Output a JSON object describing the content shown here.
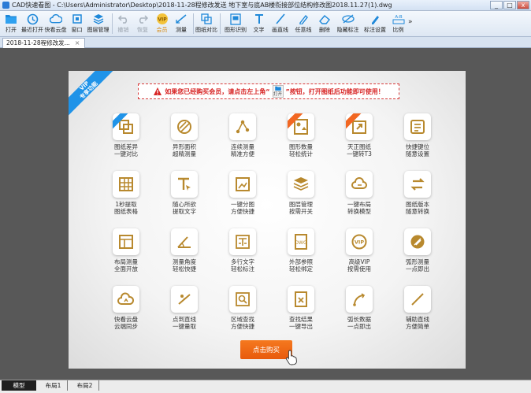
{
  "window": {
    "title": "CAD快速看图 - C:\\Users\\Administrator\\Desktop\\2018-11-28程修改发送 地下室与底AB楼衔接部位结构修改图2018.11.27(1).dwg",
    "buttons": [
      "_",
      "□",
      "x"
    ]
  },
  "toolbar": {
    "items": [
      {
        "label": "打开",
        "icon": "open-folder-icon"
      },
      {
        "label": "最近打开",
        "icon": "recent-icon"
      },
      {
        "label": "快看云盘",
        "icon": "cloud-icon"
      },
      {
        "label": "窗口",
        "icon": "window-icon"
      },
      {
        "label": "图层管理",
        "icon": "layers-icon"
      },
      {
        "label": "撤销",
        "icon": "undo-icon"
      },
      {
        "label": "恢复",
        "icon": "redo-icon"
      },
      {
        "label": "会员",
        "icon": "vip-icon"
      },
      {
        "label": "测量",
        "icon": "measure-icon"
      },
      {
        "label": "图纸对比",
        "icon": "compare-icon"
      },
      {
        "label": "图形识别",
        "icon": "recognize-icon"
      },
      {
        "label": "文字",
        "icon": "text-icon"
      },
      {
        "label": "画直线",
        "icon": "line-icon"
      },
      {
        "label": "任意线",
        "icon": "freeline-icon"
      },
      {
        "label": "删除",
        "icon": "eraser-icon"
      },
      {
        "label": "隐藏标注",
        "icon": "hide-icon"
      },
      {
        "label": "标注设置",
        "icon": "annotation-settings-icon"
      },
      {
        "label": "比例",
        "icon": "scale-icon"
      }
    ],
    "more": "»"
  },
  "doc_tab": {
    "label": "2018-11-28程修改发...",
    "close": "×"
  },
  "panel": {
    "ribbon": [
      "VIP",
      "专享功能"
    ],
    "notice_before": "如果您已经购买会员，请点击左上角“",
    "notice_open": "打开",
    "notice_after": "”按钮，打开图纸后功能即可使用！",
    "features": [
      {
        "l1": "图纸差异",
        "l2": "一键对比",
        "icon": "diff-icon",
        "badge": "new"
      },
      {
        "l1": "异形面积",
        "l2": "超精测量",
        "icon": "area-icon",
        "badge": ""
      },
      {
        "l1": "连续测量",
        "l2": "精准方便",
        "icon": "continuous-measure-icon",
        "badge": ""
      },
      {
        "l1": "图形数量",
        "l2": "轻松统计",
        "icon": "shape-count-icon",
        "badge": "hot"
      },
      {
        "l1": "天正图纸",
        "l2": "一键转T3",
        "icon": "convert-t3-icon",
        "badge": "hot"
      },
      {
        "l1": "快捷键位",
        "l2": "随意设置",
        "icon": "shortcut-icon",
        "badge": ""
      },
      {
        "l1": "1秒提取",
        "l2": "图纸表格",
        "icon": "table-extract-icon",
        "badge": ""
      },
      {
        "l1": "随心所欲",
        "l2": "提取文字",
        "icon": "text-extract-icon",
        "badge": ""
      },
      {
        "l1": "一键分图",
        "l2": "方便快捷",
        "icon": "split-drawing-icon",
        "badge": ""
      },
      {
        "l1": "图层管理",
        "l2": "按需开关",
        "icon": "layer-manage-icon",
        "badge": ""
      },
      {
        "l1": "一键布局",
        "l2": "转换模型",
        "icon": "layout-convert-icon",
        "badge": ""
      },
      {
        "l1": "图纸版本",
        "l2": "随意转换",
        "icon": "version-convert-icon",
        "badge": ""
      },
      {
        "l1": "布局测量",
        "l2": "全面开放",
        "icon": "layout-measure-icon",
        "badge": ""
      },
      {
        "l1": "测量角度",
        "l2": "轻松快捷",
        "icon": "angle-measure-icon",
        "badge": ""
      },
      {
        "l1": "多行文字",
        "l2": "轻松标注",
        "icon": "multiline-text-icon",
        "badge": ""
      },
      {
        "l1": "外部参照",
        "l2": "轻松绑定",
        "icon": "xref-icon",
        "badge": ""
      },
      {
        "l1": "高级VIP",
        "l2": "按需使用",
        "icon": "vip-badge-icon",
        "badge": ""
      },
      {
        "l1": "弧形测量",
        "l2": "一点即出",
        "icon": "arc-measure-icon",
        "badge": ""
      },
      {
        "l1": "快看云盘",
        "l2": "云端同步",
        "icon": "cloud-sync-icon",
        "badge": ""
      },
      {
        "l1": "点到直线",
        "l2": "一键量取",
        "icon": "point-line-icon",
        "badge": ""
      },
      {
        "l1": "区域查找",
        "l2": "方便快捷",
        "icon": "area-search-icon",
        "badge": ""
      },
      {
        "l1": "查找结果",
        "l2": "一键导出",
        "icon": "export-results-icon",
        "badge": ""
      },
      {
        "l1": "弧长数据",
        "l2": "一点即出",
        "icon": "arc-length-icon",
        "badge": ""
      },
      {
        "l1": "辅助直线",
        "l2": "方便简单",
        "icon": "aux-line-icon",
        "badge": ""
      }
    ],
    "buy_label": "点击购买"
  },
  "layout_tabs": [
    "模型",
    "布局1",
    "布局2"
  ],
  "colors": {
    "accent_blue": "#1f93e8",
    "accent_orange": "#f26722",
    "icon_gold": "#b8892e",
    "notice_red": "#d72424"
  }
}
